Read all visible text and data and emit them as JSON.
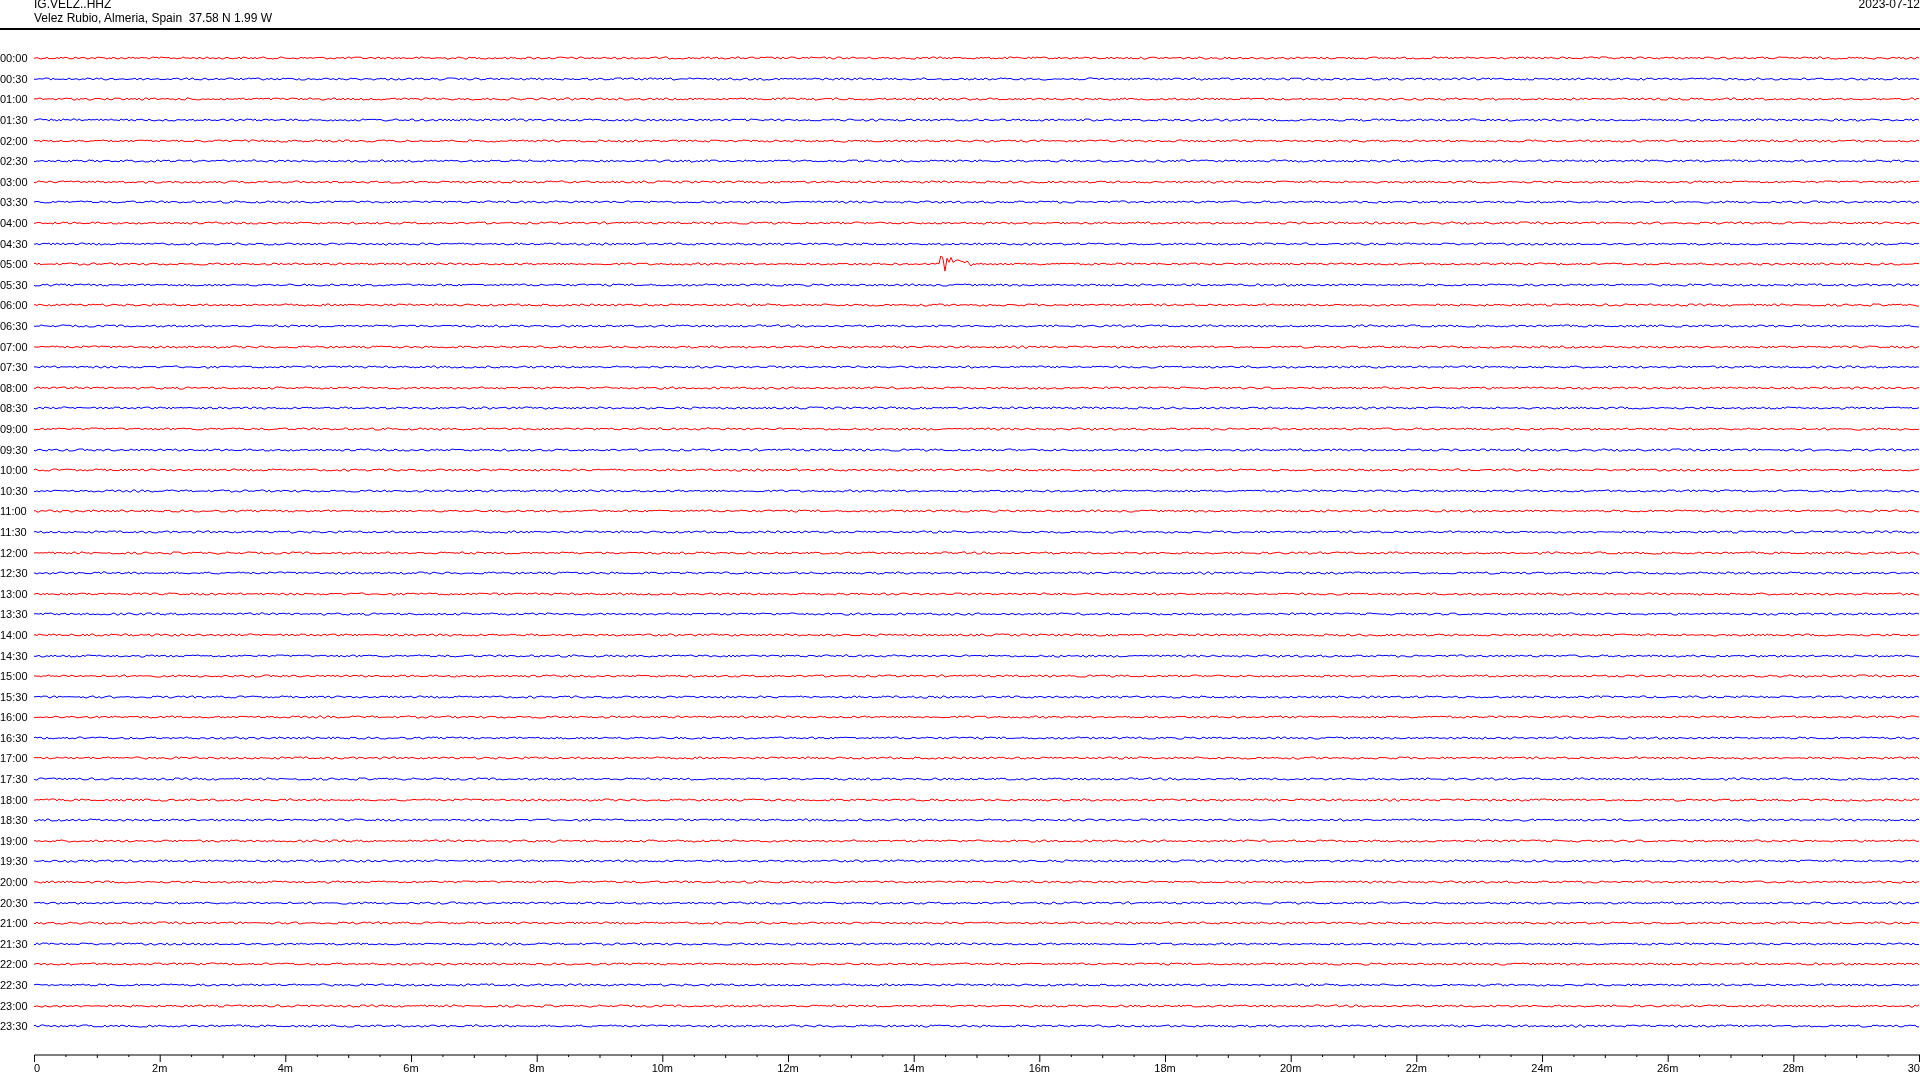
{
  "header": {
    "station": "IG.VELZ..HHZ",
    "location": "Velez Rubio, Almeria, Spain  37.58 N 1.99 W",
    "date": "2023-07-12"
  },
  "rows": [
    {
      "time": "00:00",
      "color": "#ff0000",
      "burst": false
    },
    {
      "time": "00:30",
      "color": "#0000ff",
      "burst": false
    },
    {
      "time": "01:00",
      "color": "#ff0000",
      "burst": false
    },
    {
      "time": "01:30",
      "color": "#0000ff",
      "burst": false
    },
    {
      "time": "02:00",
      "color": "#ff0000",
      "burst": false
    },
    {
      "time": "02:30",
      "color": "#0000ff",
      "burst": false
    },
    {
      "time": "03:00",
      "color": "#ff0000",
      "burst": false
    },
    {
      "time": "03:30",
      "color": "#0000ff",
      "burst": false
    },
    {
      "time": "04:00",
      "color": "#ff0000",
      "burst": false
    },
    {
      "time": "04:30",
      "color": "#0000ff",
      "burst": false
    },
    {
      "time": "05:00",
      "color": "#ff0000",
      "burst": true
    },
    {
      "time": "05:30",
      "color": "#0000ff",
      "burst": false
    },
    {
      "time": "06:00",
      "color": "#ff0000",
      "burst": false
    },
    {
      "time": "06:30",
      "color": "#0000ff",
      "burst": false
    },
    {
      "time": "07:00",
      "color": "#ff0000",
      "burst": false
    },
    {
      "time": "07:30",
      "color": "#0000ff",
      "burst": false
    },
    {
      "time": "08:00",
      "color": "#ff0000",
      "burst": false
    },
    {
      "time": "08:30",
      "color": "#0000ff",
      "burst": false
    },
    {
      "time": "09:00",
      "color": "#ff0000",
      "burst": false
    },
    {
      "time": "09:30",
      "color": "#0000ff",
      "burst": false
    },
    {
      "time": "10:00",
      "color": "#ff0000",
      "burst": false
    },
    {
      "time": "10:30",
      "color": "#0000ff",
      "burst": false
    },
    {
      "time": "11:00",
      "color": "#ff0000",
      "burst": false
    },
    {
      "time": "11:30",
      "color": "#0000ff",
      "burst": false
    },
    {
      "time": "12:00",
      "color": "#ff0000",
      "burst": false
    },
    {
      "time": "12:30",
      "color": "#0000ff",
      "burst": false
    },
    {
      "time": "13:00",
      "color": "#ff0000",
      "burst": false
    },
    {
      "time": "13:30",
      "color": "#0000ff",
      "burst": false
    },
    {
      "time": "14:00",
      "color": "#ff0000",
      "burst": false
    },
    {
      "time": "14:30",
      "color": "#0000ff",
      "burst": false
    },
    {
      "time": "15:00",
      "color": "#ff0000",
      "burst": false
    },
    {
      "time": "15:30",
      "color": "#0000ff",
      "burst": false
    },
    {
      "time": "16:00",
      "color": "#ff0000",
      "burst": false
    },
    {
      "time": "16:30",
      "color": "#0000ff",
      "burst": false
    },
    {
      "time": "17:00",
      "color": "#ff0000",
      "burst": false
    },
    {
      "time": "17:30",
      "color": "#0000ff",
      "burst": false
    },
    {
      "time": "18:00",
      "color": "#ff0000",
      "burst": false
    },
    {
      "time": "18:30",
      "color": "#0000ff",
      "burst": false
    },
    {
      "time": "19:00",
      "color": "#ff0000",
      "burst": false
    },
    {
      "time": "19:30",
      "color": "#0000ff",
      "burst": false
    },
    {
      "time": "20:00",
      "color": "#ff0000",
      "burst": false
    },
    {
      "time": "20:30",
      "color": "#0000ff",
      "burst": false
    },
    {
      "time": "21:00",
      "color": "#ff0000",
      "burst": false
    },
    {
      "time": "21:30",
      "color": "#0000ff",
      "burst": false
    },
    {
      "time": "22:00",
      "color": "#ff0000",
      "burst": false
    },
    {
      "time": "22:30",
      "color": "#0000ff",
      "burst": false
    },
    {
      "time": "23:00",
      "color": "#ff0000",
      "burst": false
    },
    {
      "time": "23:30",
      "color": "#0000ff",
      "burst": false
    }
  ],
  "x_axis": {
    "labels": [
      "0",
      "2m",
      "4m",
      "6m",
      "8m",
      "10m",
      "12m",
      "14m",
      "16m",
      "18m",
      "20m",
      "22m",
      "24m",
      "26m",
      "28m",
      "30"
    ]
  }
}
